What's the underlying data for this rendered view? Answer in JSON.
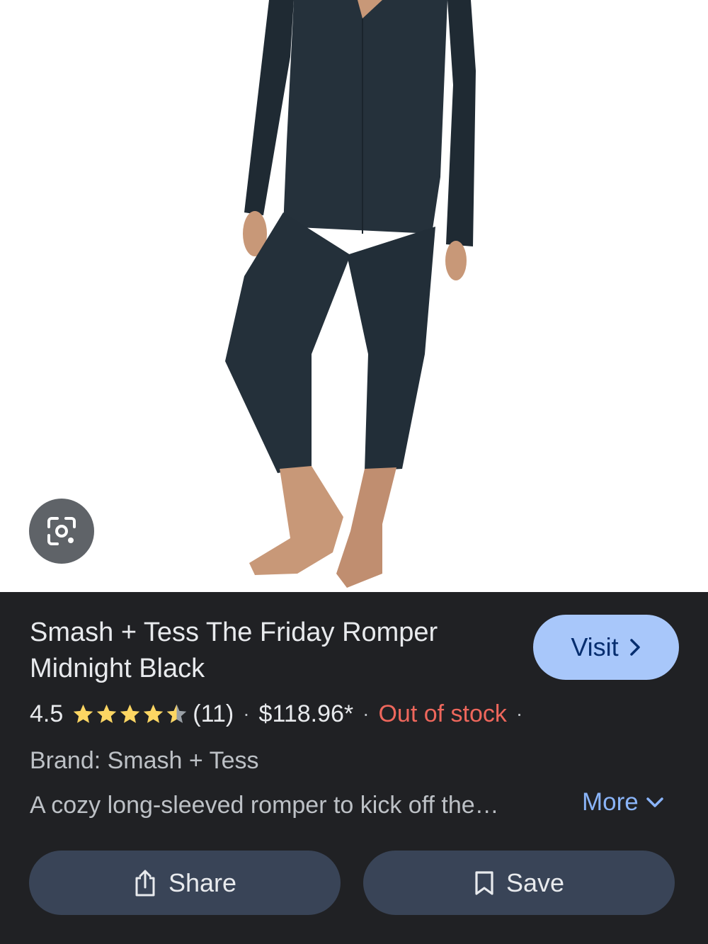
{
  "product": {
    "title": "Smash + Tess The Friday Romper Midnight Black",
    "rating": "4.5",
    "rating_value": 4.5,
    "review_count": "(11)",
    "price": "$118.96*",
    "availability": "Out of stock",
    "separator": "·",
    "brand": "Brand: Smash + Tess",
    "description": "A cozy long-sleeved romper to kick off the…"
  },
  "actions": {
    "visit_label": "Visit",
    "more_label": "More",
    "share_label": "Share",
    "save_label": "Save"
  },
  "icons": {
    "lens": "google-lens-icon",
    "visit": "chevron-right-icon",
    "more": "chevron-down-icon",
    "share": "share-icon",
    "save": "bookmark-icon",
    "rating": "star-icon"
  },
  "colors": {
    "panel_bg": "#202124",
    "visit_bg": "#a8c7fa",
    "button_bg": "#394457",
    "star": "#fdd663",
    "out_of_stock": "#ee675c",
    "link": "#8ab4f8"
  }
}
